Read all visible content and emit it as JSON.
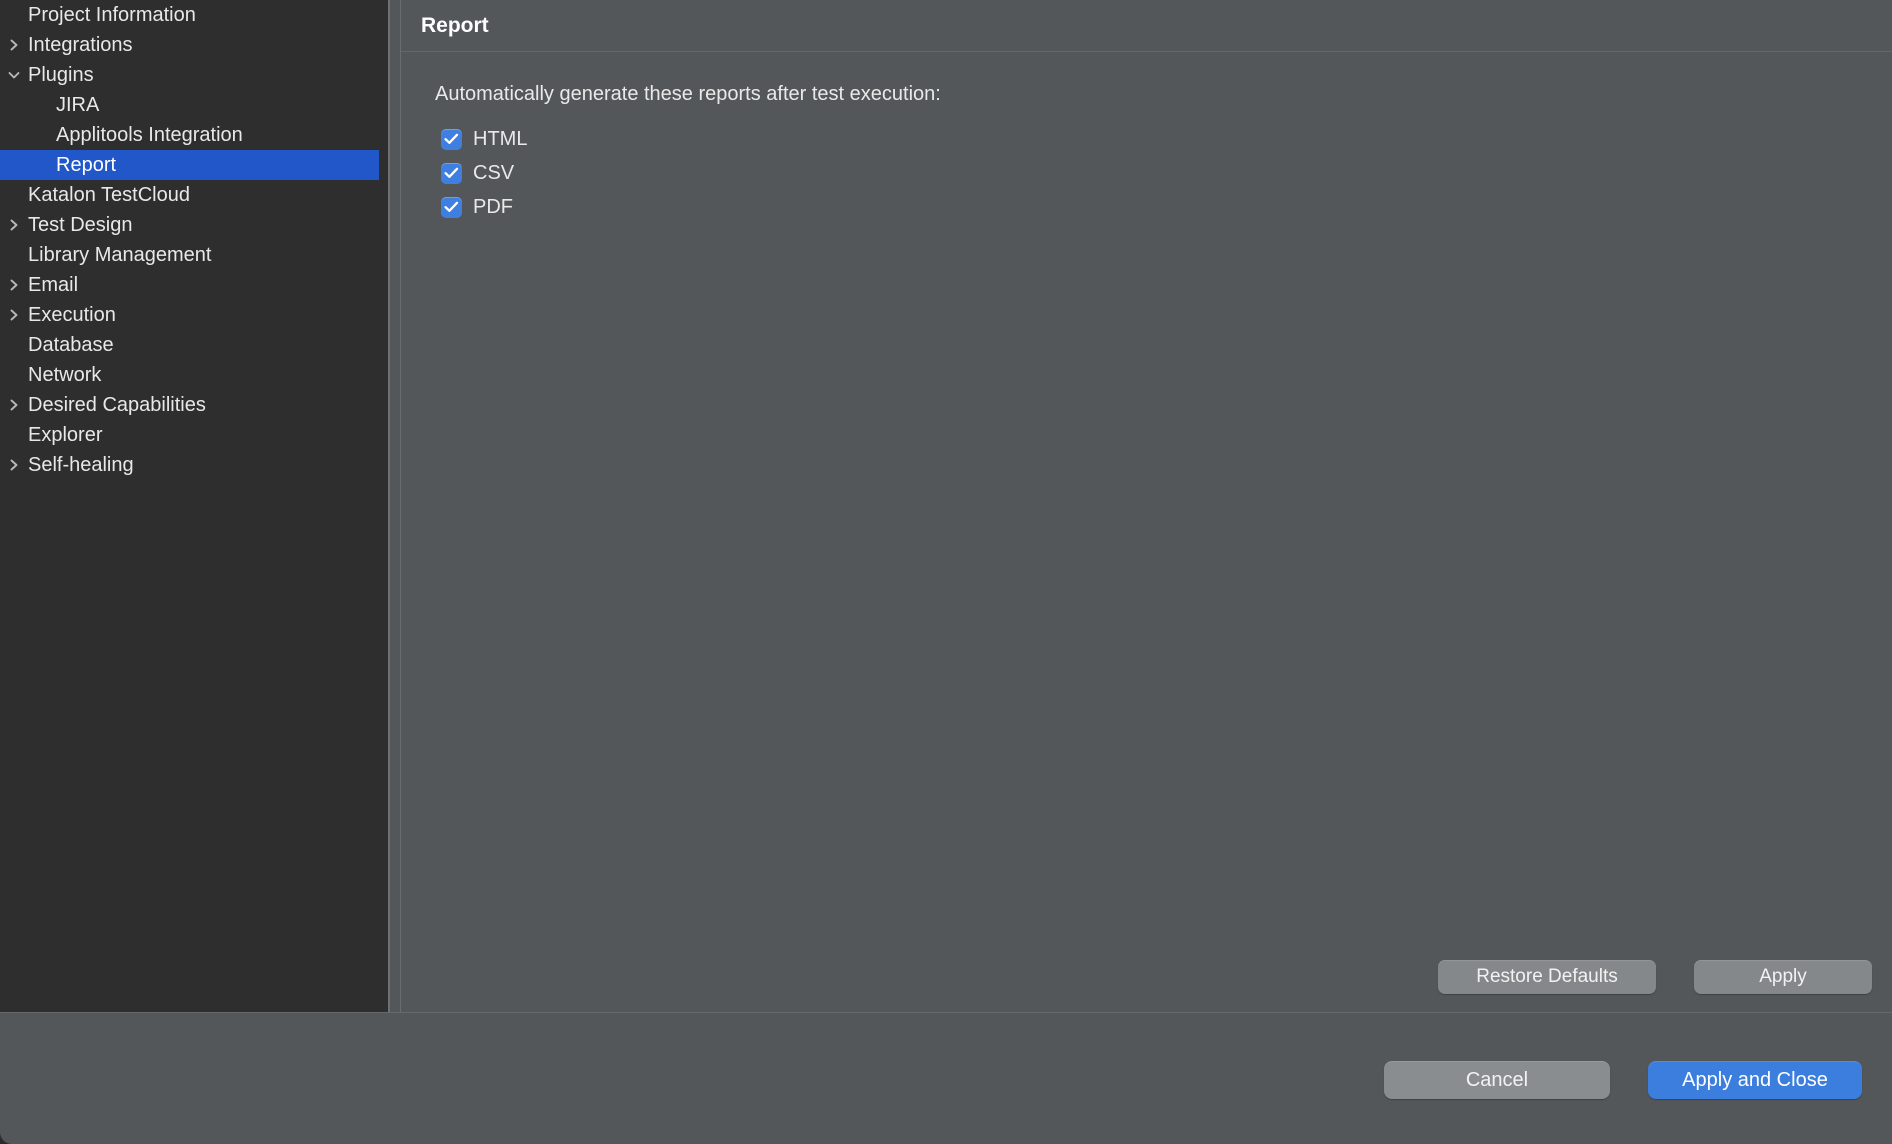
{
  "sidebar": {
    "scrollbar": "vertical-scrollbar",
    "items": [
      {
        "label": "Project Information",
        "level": 1,
        "twisty": "none",
        "selected": false
      },
      {
        "label": "Integrations",
        "level": 1,
        "twisty": "collapsed",
        "selected": false
      },
      {
        "label": "Plugins",
        "level": 1,
        "twisty": "expanded",
        "selected": false
      },
      {
        "label": "JIRA",
        "level": 2,
        "twisty": "none",
        "selected": false
      },
      {
        "label": "Applitools Integration",
        "level": 2,
        "twisty": "none",
        "selected": false
      },
      {
        "label": "Report",
        "level": 2,
        "twisty": "none",
        "selected": true
      },
      {
        "label": "Katalon TestCloud",
        "level": 1,
        "twisty": "none",
        "selected": false
      },
      {
        "label": "Test Design",
        "level": 1,
        "twisty": "collapsed",
        "selected": false
      },
      {
        "label": "Library Management",
        "level": 1,
        "twisty": "none",
        "selected": false
      },
      {
        "label": "Email",
        "level": 1,
        "twisty": "collapsed",
        "selected": false
      },
      {
        "label": "Execution",
        "level": 1,
        "twisty": "collapsed",
        "selected": false
      },
      {
        "label": "Database",
        "level": 1,
        "twisty": "none",
        "selected": false
      },
      {
        "label": "Network",
        "level": 1,
        "twisty": "none",
        "selected": false
      },
      {
        "label": "Desired Capabilities",
        "level": 1,
        "twisty": "collapsed",
        "selected": false
      },
      {
        "label": "Explorer",
        "level": 1,
        "twisty": "none",
        "selected": false
      },
      {
        "label": "Self-healing",
        "level": 1,
        "twisty": "collapsed",
        "selected": false
      }
    ]
  },
  "panel": {
    "title": "Report",
    "instruction": "Automatically generate these reports after test execution:",
    "checkboxes": [
      {
        "label": "HTML",
        "checked": true
      },
      {
        "label": "CSV",
        "checked": true
      },
      {
        "label": "PDF",
        "checked": true
      }
    ],
    "restore_defaults_label": "Restore Defaults",
    "apply_label": "Apply"
  },
  "footer": {
    "cancel_label": "Cancel",
    "apply_and_close_label": "Apply and Close"
  },
  "colors": {
    "selection_blue": "#2157c9",
    "checkbox_blue": "#3f7fe0",
    "primary_button_blue": "#3b7ede",
    "sidebar_bg": "#2e2e2e",
    "panel_bg": "#53575a"
  }
}
